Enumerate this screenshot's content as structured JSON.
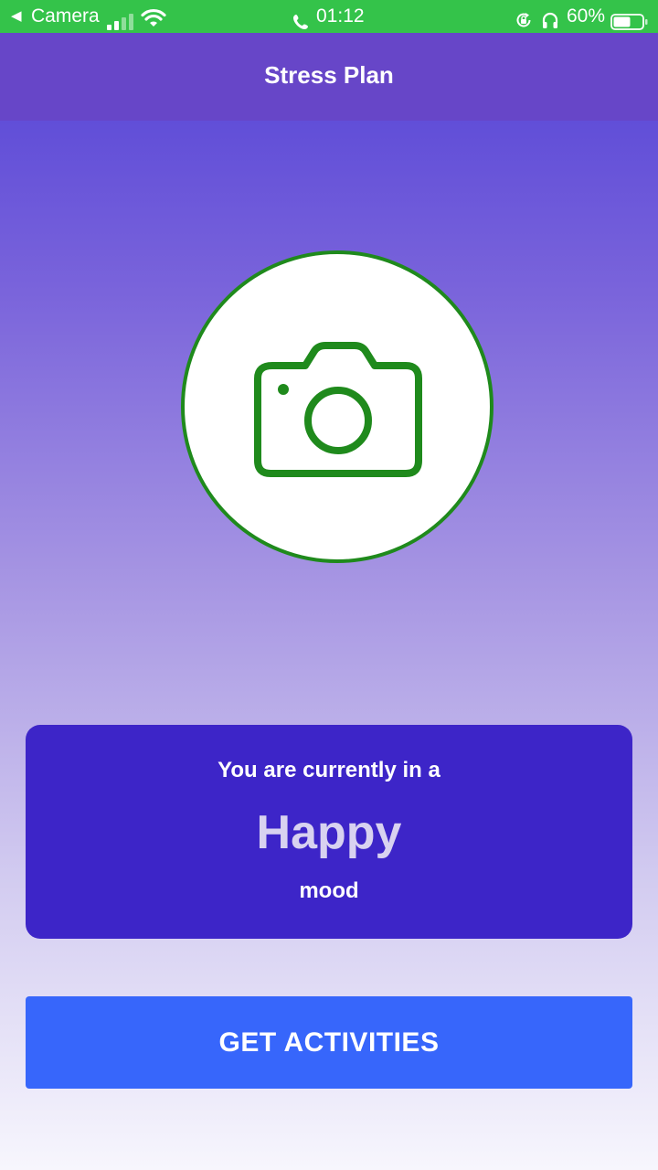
{
  "status_bar": {
    "back_arrow": "◀",
    "carrier": "Camera",
    "time": "01:12",
    "battery_percent": "60%",
    "background_color": "#34c34a",
    "signal_bars_filled": 2,
    "signal_bars_total": 4,
    "battery_level": 0.6
  },
  "header": {
    "title": "Stress Plan",
    "background_color": "#6746c8"
  },
  "camera": {
    "icon": "camera-icon",
    "accent_color": "#1f8a1c"
  },
  "mood_card": {
    "prefix": "You are currently in a",
    "mood": "Happy",
    "suffix": "mood",
    "background_color": "#3d25c8"
  },
  "actions": {
    "get_activities_label": "GET ACTIVITIES",
    "button_color": "#3766fb"
  }
}
